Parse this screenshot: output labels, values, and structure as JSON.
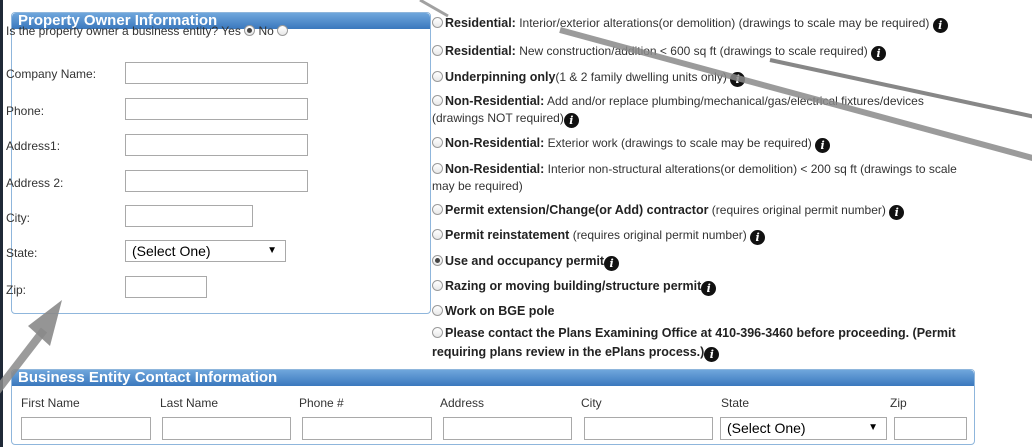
{
  "owner": {
    "header": "Property Owner Information",
    "entity_question": "Is the property owner a business entity?",
    "yes_label": "Yes",
    "no_label": "No",
    "company_label": "Company Name:",
    "phone_label": "Phone:",
    "address1_label": "Address1:",
    "address2_label": "Address 2:",
    "city_label": "City:",
    "state_label": "State:",
    "state_value": "(Select One)",
    "zip_label": "Zip:"
  },
  "permits": [
    {
      "bold": "Residential:",
      "text": " Interior/exterior alterations(or demolition) (drawings to scale may be required)",
      "cont": ""
    },
    {
      "bold": "Residential:",
      "text": " New construction/addition < 600 sq ft (drawings to scale required)",
      "cont": ""
    },
    {
      "bold": "Underpinning only",
      "text": "(1 & 2 family dwelling units only)",
      "cont": ""
    },
    {
      "bold": "Non-Residential:",
      "text": " Add and/or replace plumbing/mechanical/gas/electrical fixtures/devices",
      "cont": "(drawings NOT required)"
    },
    {
      "bold": "Non-Residential:",
      "text": " Exterior work (drawings to scale may be required)",
      "cont": ""
    },
    {
      "bold": "Non-Residential:",
      "text": " Interior non-structural alterations(or demolition) < 200 sq ft (drawings to scale",
      "cont": "may be required)"
    },
    {
      "bold": "Permit extension/Change(or Add) contractor",
      "text": " (requires original permit number)",
      "cont": ""
    },
    {
      "bold": "Permit reinstatement",
      "text": " (requires original permit number)",
      "cont": ""
    },
    {
      "bold": "Use and occupancy permit",
      "text": "",
      "cont": ""
    },
    {
      "bold": "Razing or moving building/structure permit",
      "text": "",
      "cont": ""
    },
    {
      "bold": "Work on BGE pole",
      "text": "",
      "cont": ""
    },
    {
      "bold": "Please contact the Plans Examining Office at 410-396-3460 before proceeding. (Permit",
      "text": "",
      "cont": "requiring plans review in the ePlans process.)"
    }
  ],
  "business": {
    "header": "Business Entity Contact Information",
    "first_name": "First Name",
    "last_name": "Last Name",
    "phone": "Phone #",
    "address": "Address",
    "city": "City",
    "state": "State",
    "zip": "Zip",
    "state_value": "(Select One)"
  },
  "icons": {
    "info": "info-icon"
  }
}
